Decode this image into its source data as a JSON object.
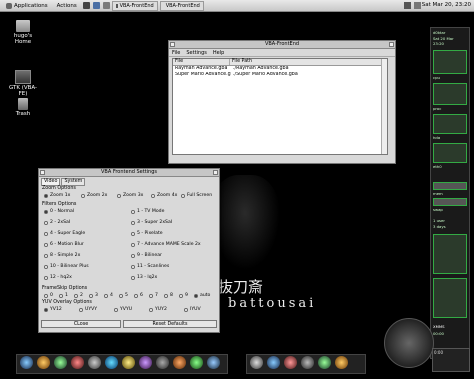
{
  "panel": {
    "applications": "Applications",
    "actions": "Actions",
    "tasks": [
      "VBA-FrontEnd",
      "VBA-FrontEnd"
    ],
    "clock": "Sat Mar 20, 23:20"
  },
  "desktop": {
    "icons": [
      {
        "label": "hugo's Home"
      },
      {
        "label": "GTK (VBA-FE)"
      },
      {
        "label": "Trash"
      }
    ],
    "wallpaper_text": "battousai",
    "wallpaper_kanji": "抜刀斎"
  },
  "frontend": {
    "title": "VBA-FrontEnd",
    "menu": [
      "File",
      "Settings",
      "Help"
    ],
    "columns": [
      "File",
      "File Path"
    ],
    "rows": [
      {
        "file": "Rayman Advance.gba",
        "path": "./Rayman Advance.gba"
      },
      {
        "file": "Super Mario Advance.gba",
        "path": "./Super Mario Advance.gba"
      }
    ]
  },
  "settings": {
    "title": "VBA Frontend Settings",
    "tabs": [
      "Video",
      "System"
    ],
    "zoom_title": "Zoom Options",
    "zoom": [
      "Zoom 1x",
      "Zoom 2x",
      "Zoom 3x",
      "Zoom 4x",
      "Full Screen"
    ],
    "filters_title": "Filters Options",
    "filters": [
      "0 - Normal",
      "1 - TV Mode",
      "2 - 2xSaI",
      "3 - Super 2xSaI",
      "4 - Super Eagle",
      "5 - Pixelate",
      "6 - Motion Blur",
      "7 - Advance MAME Scale 2x",
      "8 - Simple 2x",
      "9 - Bilinear",
      "10 - Bilinear Plus",
      "11 - Scanlines",
      "12 - hq2x",
      "13 - lq2x"
    ],
    "frameskip_title": "FrameSkip Options",
    "frameskip": [
      "0",
      "1",
      "2",
      "3",
      "4",
      "5",
      "6",
      "7",
      "8",
      "9",
      "auto"
    ],
    "yuv_title": "YUV Overlay Options",
    "yuv": [
      "YV12",
      "UYVY",
      "YVYU",
      "YUY2",
      "IYUV"
    ],
    "close_label": "CLose",
    "reset_label": "Reset Defaults"
  },
  "gkrellm": {
    "lines": [
      "d0ktar",
      "Sat 20 Mar",
      "23:20",
      "cpu",
      "proc",
      "hda",
      "eth0",
      "mem",
      "swap",
      "1 user",
      "3 days"
    ],
    "bottom": [
      "XMMS",
      "00:00",
      "0:00"
    ]
  },
  "colors": {
    "wallpaper": "#000000",
    "window": "#d9d9d9",
    "accent": "#4a90d9"
  }
}
